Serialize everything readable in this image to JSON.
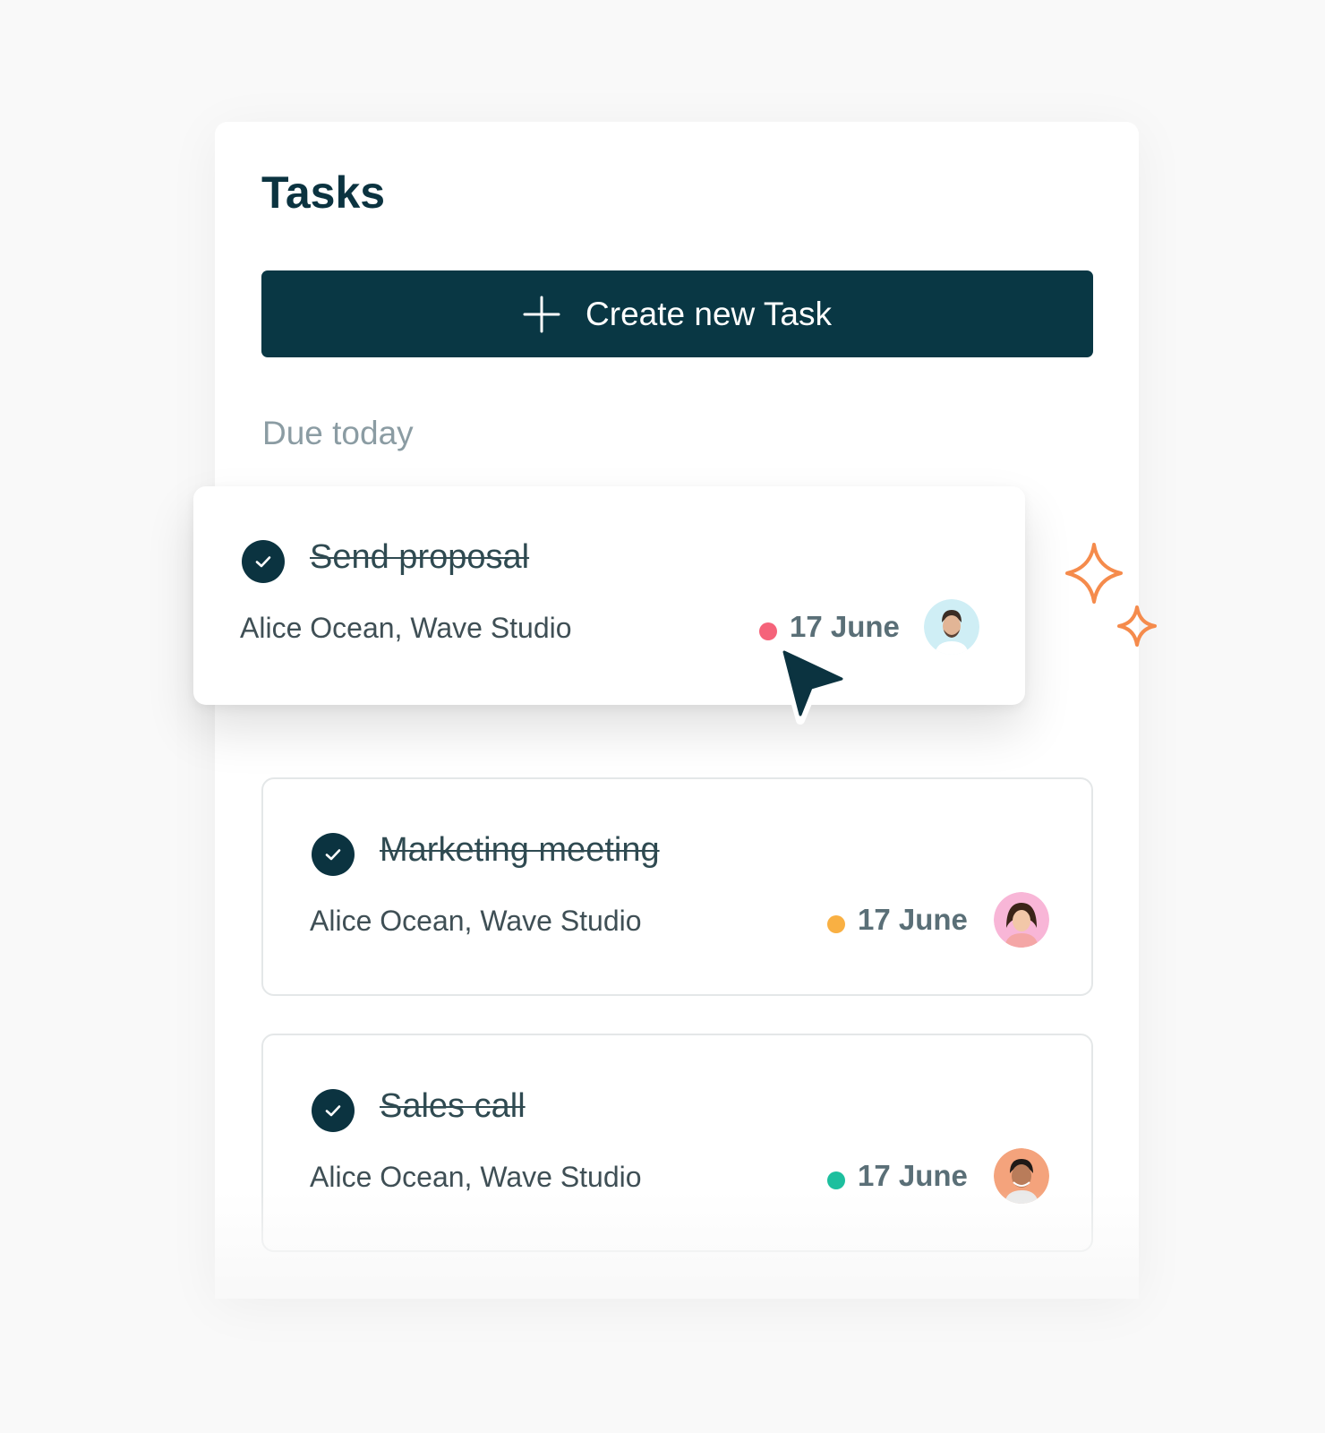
{
  "header": {
    "title": "Tasks"
  },
  "create_button": {
    "label": "Create new Task"
  },
  "section": {
    "label": "Due today"
  },
  "tasks": [
    {
      "title": "Send proposal",
      "meta": "Alice Ocean, Wave Studio",
      "date": "17 June",
      "status_color": "#f5637a",
      "completed": true
    },
    {
      "title": "Marketing meeting",
      "meta": "Alice Ocean, Wave Studio",
      "date": "17 June",
      "status_color": "#f9b043",
      "completed": true
    },
    {
      "title": "Sales call",
      "meta": "Alice Ocean, Wave Studio",
      "date": "17 June",
      "status_color": "#1dbf9e",
      "completed": true
    }
  ],
  "colors": {
    "primary": "#093744",
    "accent_sparkle": "#f58b4c",
    "muted_text": "#8b9ca3"
  },
  "icons": [
    "plus-icon",
    "check-icon",
    "cursor-icon",
    "sparkle-icon"
  ]
}
